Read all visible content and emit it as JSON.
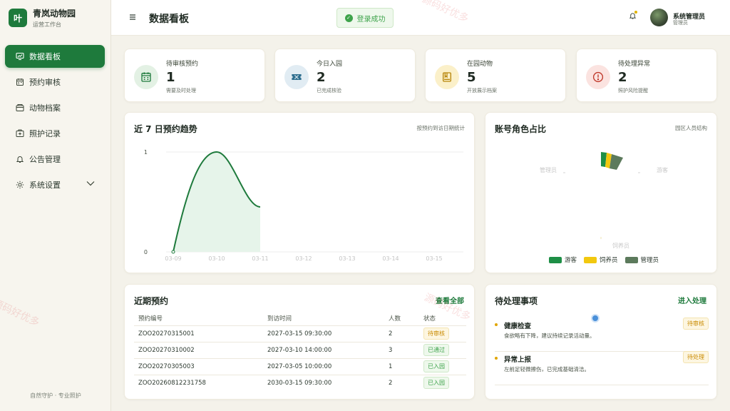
{
  "brand": {
    "logo_text": "叶",
    "title": "青岚动物园",
    "subtitle": "运营工作台"
  },
  "sidebar": {
    "items": [
      {
        "label": "数据看板",
        "icon": "chart-icon",
        "active": true
      },
      {
        "label": "预约审核",
        "icon": "calendar-icon"
      },
      {
        "label": "动物档案",
        "icon": "folder-icon"
      },
      {
        "label": "照护记录",
        "icon": "medical-icon"
      },
      {
        "label": "公告管理",
        "icon": "bell-icon"
      },
      {
        "label": "系统设置",
        "icon": "gear-icon",
        "has_submenu": true
      }
    ],
    "footer": "自然守护 · 专业照护"
  },
  "header": {
    "title": "数据看板",
    "toast": "登录成功",
    "user_name": "系统管理员",
    "user_role": "管理员"
  },
  "stats": [
    {
      "label": "待审核预约",
      "value": "1",
      "sub": "需要及时处理",
      "icon": "calendar-icon",
      "color": "#1e7a3c",
      "bg": "#e3f1e4"
    },
    {
      "label": "今日入园",
      "value": "2",
      "sub": "已完成核验",
      "icon": "ticket-icon",
      "color": "#2f6f8f",
      "bg": "#e1ecf3"
    },
    {
      "label": "在园动物",
      "value": "5",
      "sub": "开放展示档案",
      "icon": "book-icon",
      "color": "#b8860b",
      "bg": "#fbf0c9"
    },
    {
      "label": "待处理异常",
      "value": "2",
      "sub": "照护风险提醒",
      "icon": "alert-icon",
      "color": "#c0392b",
      "bg": "#fbe3e0"
    }
  ],
  "trend": {
    "title": "近 7 日预约趋势",
    "note": "按预约到访日期统计"
  },
  "chart_data": [
    {
      "type": "area",
      "title": "近 7 日预约趋势",
      "categories": [
        "03-09",
        "03-10",
        "03-11",
        "03-12",
        "03-13",
        "03-14",
        "03-15"
      ],
      "y_ticks": [
        "0",
        "1"
      ],
      "ylim": [
        0,
        1
      ],
      "series": [
        {
          "values": [
            0,
            1,
            0.45
          ]
        }
      ],
      "color": "#1e7a3c",
      "fill": "#e6f4ea",
      "grid": true
    },
    {
      "type": "pie",
      "title": "账号角色占比",
      "note": "园区人员结构",
      "legend": [
        "游客",
        "饲养员",
        "管理员"
      ],
      "colors": [
        "#1e8f46",
        "#f2c80f",
        "#5c7a5c"
      ],
      "slice_labels": [
        "管理员",
        "游客",
        "饲养员"
      ],
      "legend_position": "bottom"
    }
  ],
  "recent": {
    "title": "近期预约",
    "link": "查看全部",
    "columns": [
      "预约编号",
      "到访时间",
      "人数",
      "状态"
    ],
    "rows": [
      {
        "id": "ZOO20270315001",
        "time": "2027-03-15 09:30:00",
        "count": "2",
        "status": "待审核",
        "kind": "pending"
      },
      {
        "id": "ZOO20270310002",
        "time": "2027-03-10 14:00:00",
        "count": "3",
        "status": "已通过",
        "kind": "passed"
      },
      {
        "id": "ZOO20270305003",
        "time": "2027-03-05 10:00:00",
        "count": "1",
        "status": "已入园",
        "kind": "passed"
      },
      {
        "id": "ZOO20260812231758",
        "time": "2030-03-15 09:30:00",
        "count": "2",
        "status": "已入园",
        "kind": "passed"
      }
    ]
  },
  "todo": {
    "title": "待处理事项",
    "link": "进入处理",
    "items": [
      {
        "title": "健康检查",
        "desc": "食欲略有下降，建议持续记录活动量。",
        "tag": "待审核"
      },
      {
        "title": "异常上报",
        "desc": "左前足轻微擦伤，已完成基础清洁。",
        "tag": "待处理"
      }
    ]
  },
  "watermarks": [
    "源码好优多",
    "源码好优多",
    "源码好优多"
  ]
}
